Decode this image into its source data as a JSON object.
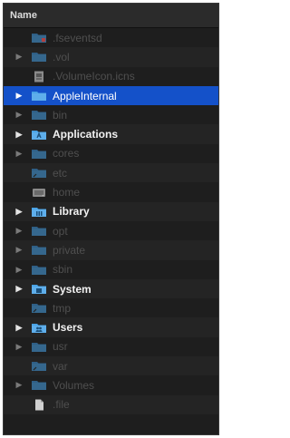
{
  "header": {
    "name_label": "Name"
  },
  "colors": {
    "folder": "#4aa3e6",
    "folder_dim": "#2f5f86",
    "selection": "#1451c9"
  },
  "items": [
    {
      "label": ".fseventsd",
      "icon": "folder-icon-locked",
      "expandable": false,
      "style": "dim"
    },
    {
      "label": ".vol",
      "icon": "folder-icon",
      "expandable": true,
      "style": "dim"
    },
    {
      "label": ".VolumeIcon.icns",
      "icon": "icns-file-icon",
      "expandable": false,
      "style": "dim"
    },
    {
      "label": "AppleInternal",
      "icon": "folder-icon",
      "expandable": true,
      "style": "selected"
    },
    {
      "label": "bin",
      "icon": "folder-icon",
      "expandable": true,
      "style": "dim"
    },
    {
      "label": "Applications",
      "icon": "applications-folder-icon",
      "expandable": true,
      "style": "bold"
    },
    {
      "label": "cores",
      "icon": "folder-icon",
      "expandable": true,
      "style": "dim"
    },
    {
      "label": "etc",
      "icon": "alias-folder-icon",
      "expandable": false,
      "style": "dim"
    },
    {
      "label": "home",
      "icon": "home-drive-icon",
      "expandable": false,
      "style": "dim"
    },
    {
      "label": "Library",
      "icon": "library-folder-icon",
      "expandable": true,
      "style": "bold"
    },
    {
      "label": "opt",
      "icon": "folder-icon",
      "expandable": true,
      "style": "dim"
    },
    {
      "label": "private",
      "icon": "folder-icon",
      "expandable": true,
      "style": "dim"
    },
    {
      "label": "sbin",
      "icon": "folder-icon",
      "expandable": true,
      "style": "dim"
    },
    {
      "label": "System",
      "icon": "system-folder-icon",
      "expandable": true,
      "style": "bold"
    },
    {
      "label": "tmp",
      "icon": "alias-folder-icon",
      "expandable": false,
      "style": "dim"
    },
    {
      "label": "Users",
      "icon": "users-folder-icon",
      "expandable": true,
      "style": "bold"
    },
    {
      "label": "usr",
      "icon": "folder-icon",
      "expandable": true,
      "style": "dim"
    },
    {
      "label": "var",
      "icon": "alias-folder-icon",
      "expandable": false,
      "style": "dim"
    },
    {
      "label": "Volumes",
      "icon": "folder-icon",
      "expandable": true,
      "style": "dim"
    },
    {
      "label": ".file",
      "icon": "document-icon",
      "expandable": false,
      "style": "dim"
    }
  ]
}
